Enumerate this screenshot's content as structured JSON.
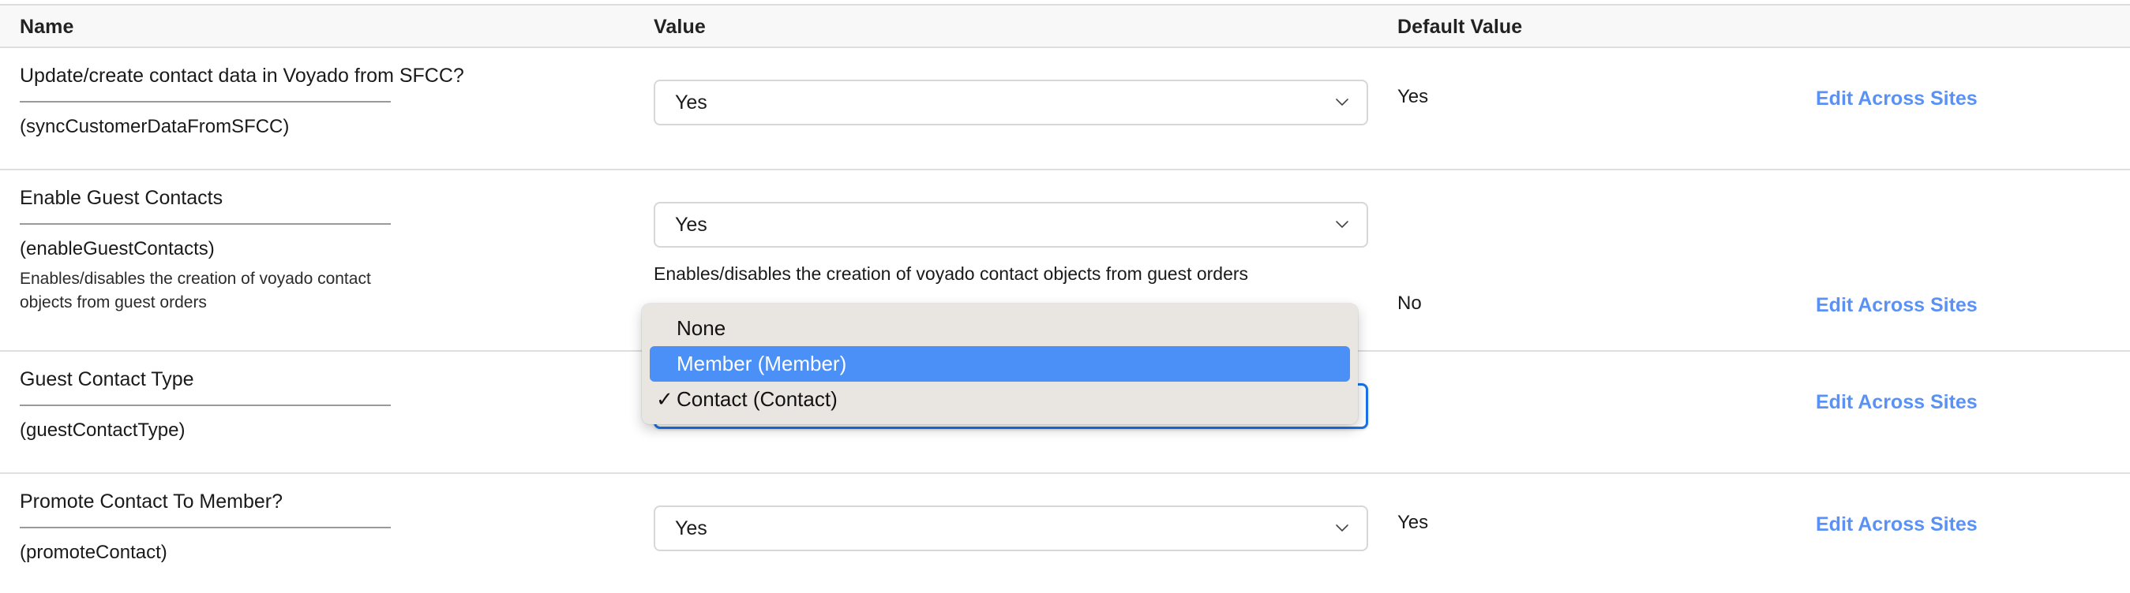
{
  "table": {
    "columns": {
      "name": "Name",
      "value": "Value",
      "default_value": "Default Value"
    },
    "edit_link_label": "Edit Across Sites",
    "rows": [
      {
        "title": "Update/create contact data in Voyado from SFCC?",
        "key": "(syncCustomerDataFromSFCC)",
        "description": "",
        "value": "Yes",
        "value_description": "",
        "default_value": "Yes",
        "edit_link": "Edit Across Sites"
      },
      {
        "title": "Enable Guest Contacts",
        "key": "(enableGuestContacts)",
        "description": "Enables/disables the creation of voyado contact objects from guest orders",
        "value": "Yes",
        "value_description": "Enables/disables the creation of voyado contact objects from guest orders",
        "default_value": "No",
        "edit_link": "Edit Across Sites"
      },
      {
        "title": "Guest Contact Type",
        "key": "(guestContactType)",
        "description": "",
        "value": "Contact (Contact)",
        "value_description": "",
        "default_value": "",
        "edit_link": "Edit Across Sites"
      },
      {
        "title": "Promote Contact To Member?",
        "key": "(promoteContact)",
        "description": "",
        "value": "Yes",
        "value_description": "",
        "default_value": "Yes",
        "edit_link": "Edit Across Sites"
      }
    ]
  },
  "dropdown": {
    "open": true,
    "belongs_to": "guestContactType",
    "highlight_color": "#4a90f7",
    "background_color": "#e9e5e1",
    "options": [
      {
        "label": "None",
        "checked": false,
        "highlighted": false
      },
      {
        "label": "Member (Member)",
        "checked": false,
        "highlighted": true
      },
      {
        "label": "Contact (Contact)",
        "checked": true,
        "highlighted": false
      }
    ],
    "check_glyph": "✓"
  },
  "icons": {
    "chevron_down": "chevron-down-icon"
  }
}
